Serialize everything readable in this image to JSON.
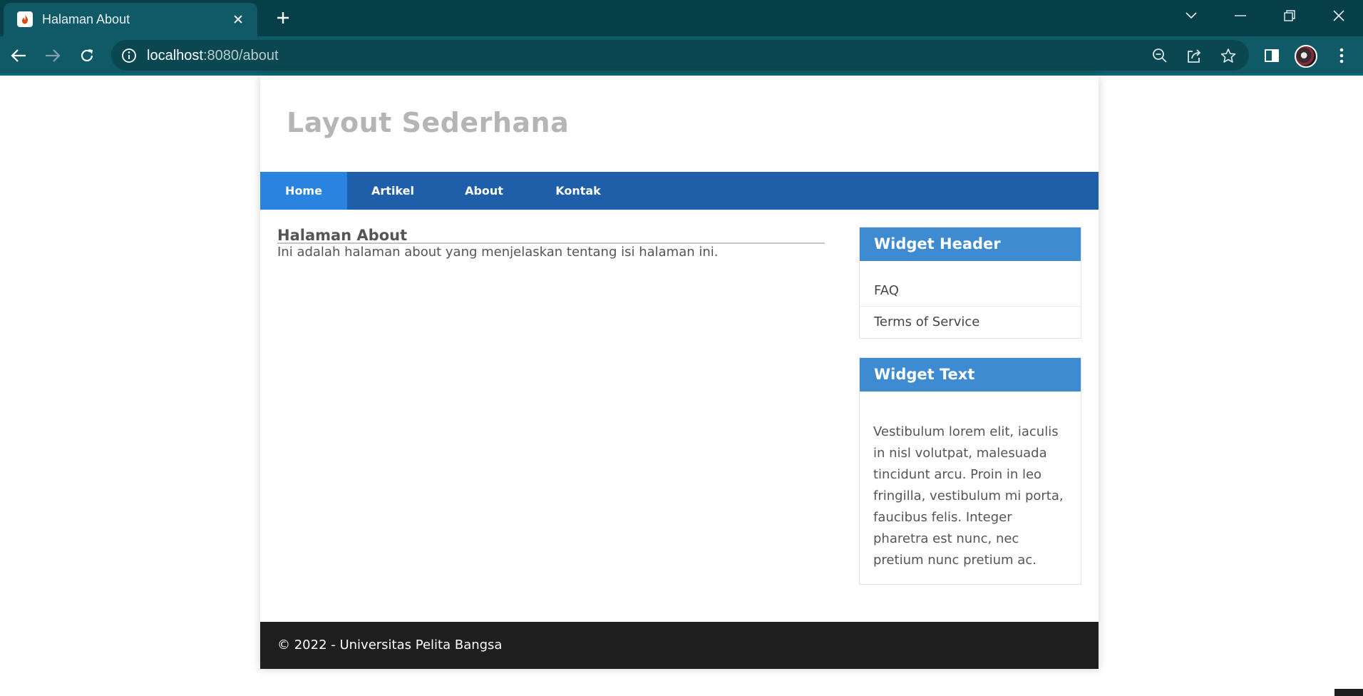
{
  "browser": {
    "tab_title": "Halaman About",
    "url_host": "localhost",
    "url_rest": ":8080/about",
    "theme_color": "#0f5a66",
    "icons": {
      "favicon": "codeigniter-flame-icon",
      "close": "close-icon",
      "new_tab": "plus-icon",
      "tab_search": "chevron-down-icon",
      "minimize": "minimize-icon",
      "restore": "restore-icon",
      "window_close": "window-close-icon",
      "back": "back-arrow-icon",
      "forward": "forward-arrow-icon",
      "reload": "reload-icon",
      "site_info": "info-icon",
      "zoom": "zoom-out-icon",
      "share": "share-icon",
      "bookmark": "star-icon",
      "side_panel": "side-panel-icon",
      "menu": "kebab-menu-icon"
    }
  },
  "site": {
    "title": "Layout Sederhana",
    "nav": [
      {
        "label": "Home",
        "active": true
      },
      {
        "label": "Artikel",
        "active": false
      },
      {
        "label": "About",
        "active": false
      },
      {
        "label": "Kontak",
        "active": false
      }
    ],
    "nav_color": "#1f5faa",
    "nav_active_color": "#2b83e0"
  },
  "main": {
    "heading": "Halaman About",
    "text": "Ini adalah halaman about yang menjelaskan tentang isi halaman ini."
  },
  "sidebar": {
    "widget_header": {
      "title": "Widget Header",
      "links": [
        "FAQ",
        "Terms of Service"
      ]
    },
    "widget_text": {
      "title": "Widget Text",
      "body": "Vestibulum lorem elit, iaculis in nisl volutpat, malesuada tincidunt arcu. Proin in leo fringilla, vestibulum mi porta, faucibus felis. Integer pharetra est nunc, nec pretium nunc pretium ac."
    },
    "widget_color": "#3f8bd1"
  },
  "footer": {
    "text": "© 2022 - Universitas Pelita Bangsa"
  }
}
